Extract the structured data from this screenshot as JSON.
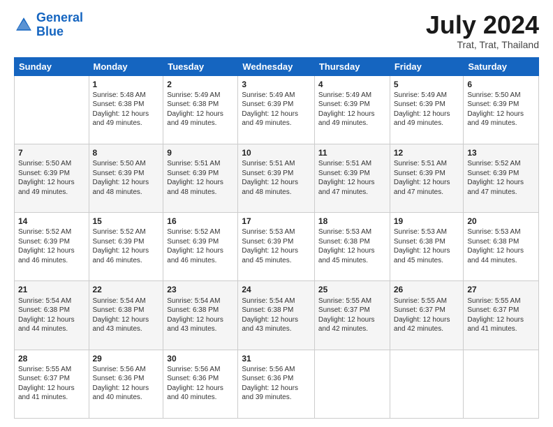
{
  "logo": {
    "line1": "General",
    "line2": "Blue"
  },
  "title": "July 2024",
  "subtitle": "Trat, Trat, Thailand",
  "days_of_week": [
    "Sunday",
    "Monday",
    "Tuesday",
    "Wednesday",
    "Thursday",
    "Friday",
    "Saturday"
  ],
  "weeks": [
    [
      {
        "num": "",
        "info": ""
      },
      {
        "num": "1",
        "info": "Sunrise: 5:48 AM\nSunset: 6:38 PM\nDaylight: 12 hours\nand 49 minutes."
      },
      {
        "num": "2",
        "info": "Sunrise: 5:49 AM\nSunset: 6:38 PM\nDaylight: 12 hours\nand 49 minutes."
      },
      {
        "num": "3",
        "info": "Sunrise: 5:49 AM\nSunset: 6:39 PM\nDaylight: 12 hours\nand 49 minutes."
      },
      {
        "num": "4",
        "info": "Sunrise: 5:49 AM\nSunset: 6:39 PM\nDaylight: 12 hours\nand 49 minutes."
      },
      {
        "num": "5",
        "info": "Sunrise: 5:49 AM\nSunset: 6:39 PM\nDaylight: 12 hours\nand 49 minutes."
      },
      {
        "num": "6",
        "info": "Sunrise: 5:50 AM\nSunset: 6:39 PM\nDaylight: 12 hours\nand 49 minutes."
      }
    ],
    [
      {
        "num": "7",
        "info": "Sunrise: 5:50 AM\nSunset: 6:39 PM\nDaylight: 12 hours\nand 49 minutes."
      },
      {
        "num": "8",
        "info": "Sunrise: 5:50 AM\nSunset: 6:39 PM\nDaylight: 12 hours\nand 48 minutes."
      },
      {
        "num": "9",
        "info": "Sunrise: 5:51 AM\nSunset: 6:39 PM\nDaylight: 12 hours\nand 48 minutes."
      },
      {
        "num": "10",
        "info": "Sunrise: 5:51 AM\nSunset: 6:39 PM\nDaylight: 12 hours\nand 48 minutes."
      },
      {
        "num": "11",
        "info": "Sunrise: 5:51 AM\nSunset: 6:39 PM\nDaylight: 12 hours\nand 47 minutes."
      },
      {
        "num": "12",
        "info": "Sunrise: 5:51 AM\nSunset: 6:39 PM\nDaylight: 12 hours\nand 47 minutes."
      },
      {
        "num": "13",
        "info": "Sunrise: 5:52 AM\nSunset: 6:39 PM\nDaylight: 12 hours\nand 47 minutes."
      }
    ],
    [
      {
        "num": "14",
        "info": "Sunrise: 5:52 AM\nSunset: 6:39 PM\nDaylight: 12 hours\nand 46 minutes."
      },
      {
        "num": "15",
        "info": "Sunrise: 5:52 AM\nSunset: 6:39 PM\nDaylight: 12 hours\nand 46 minutes."
      },
      {
        "num": "16",
        "info": "Sunrise: 5:52 AM\nSunset: 6:39 PM\nDaylight: 12 hours\nand 46 minutes."
      },
      {
        "num": "17",
        "info": "Sunrise: 5:53 AM\nSunset: 6:39 PM\nDaylight: 12 hours\nand 45 minutes."
      },
      {
        "num": "18",
        "info": "Sunrise: 5:53 AM\nSunset: 6:38 PM\nDaylight: 12 hours\nand 45 minutes."
      },
      {
        "num": "19",
        "info": "Sunrise: 5:53 AM\nSunset: 6:38 PM\nDaylight: 12 hours\nand 45 minutes."
      },
      {
        "num": "20",
        "info": "Sunrise: 5:53 AM\nSunset: 6:38 PM\nDaylight: 12 hours\nand 44 minutes."
      }
    ],
    [
      {
        "num": "21",
        "info": "Sunrise: 5:54 AM\nSunset: 6:38 PM\nDaylight: 12 hours\nand 44 minutes."
      },
      {
        "num": "22",
        "info": "Sunrise: 5:54 AM\nSunset: 6:38 PM\nDaylight: 12 hours\nand 43 minutes."
      },
      {
        "num": "23",
        "info": "Sunrise: 5:54 AM\nSunset: 6:38 PM\nDaylight: 12 hours\nand 43 minutes."
      },
      {
        "num": "24",
        "info": "Sunrise: 5:54 AM\nSunset: 6:38 PM\nDaylight: 12 hours\nand 43 minutes."
      },
      {
        "num": "25",
        "info": "Sunrise: 5:55 AM\nSunset: 6:37 PM\nDaylight: 12 hours\nand 42 minutes."
      },
      {
        "num": "26",
        "info": "Sunrise: 5:55 AM\nSunset: 6:37 PM\nDaylight: 12 hours\nand 42 minutes."
      },
      {
        "num": "27",
        "info": "Sunrise: 5:55 AM\nSunset: 6:37 PM\nDaylight: 12 hours\nand 41 minutes."
      }
    ],
    [
      {
        "num": "28",
        "info": "Sunrise: 5:55 AM\nSunset: 6:37 PM\nDaylight: 12 hours\nand 41 minutes."
      },
      {
        "num": "29",
        "info": "Sunrise: 5:56 AM\nSunset: 6:36 PM\nDaylight: 12 hours\nand 40 minutes."
      },
      {
        "num": "30",
        "info": "Sunrise: 5:56 AM\nSunset: 6:36 PM\nDaylight: 12 hours\nand 40 minutes."
      },
      {
        "num": "31",
        "info": "Sunrise: 5:56 AM\nSunset: 6:36 PM\nDaylight: 12 hours\nand 39 minutes."
      },
      {
        "num": "",
        "info": ""
      },
      {
        "num": "",
        "info": ""
      },
      {
        "num": "",
        "info": ""
      }
    ]
  ]
}
